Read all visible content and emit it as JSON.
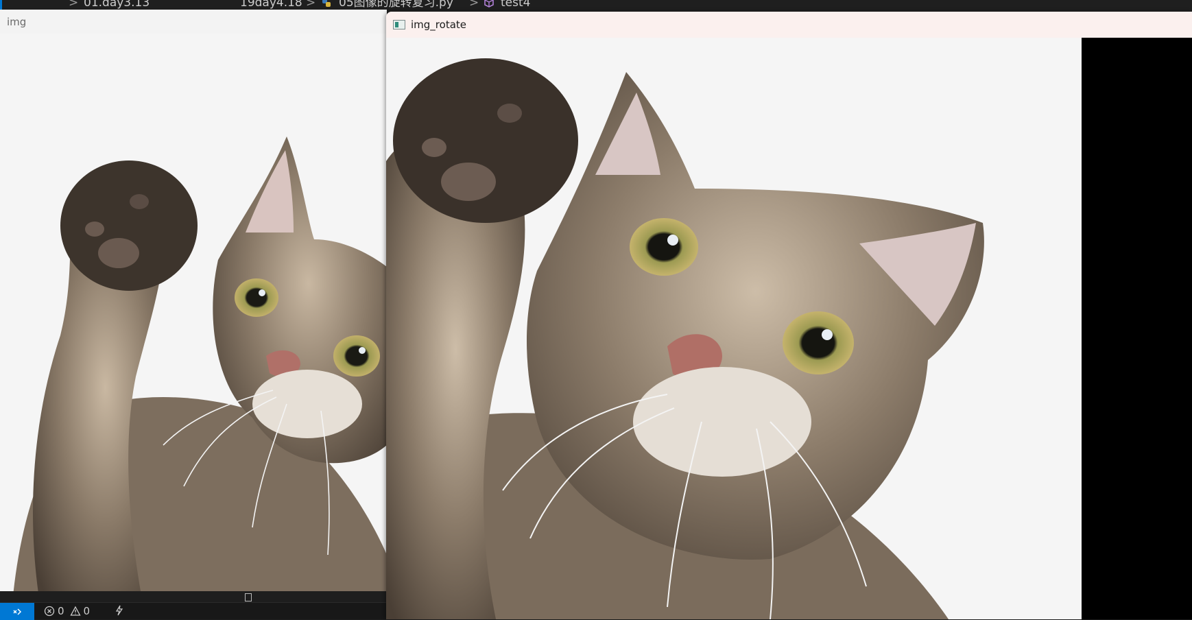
{
  "editor": {
    "breadcrumb": {
      "folder": "01.day3.13",
      "subfolder": "19day4.18",
      "file": "05图像的旋转复习.py",
      "symbol": "test4"
    },
    "statusbar": {
      "errors": "0",
      "warnings": "0"
    }
  },
  "windows": {
    "img": {
      "title": "img",
      "image_subject": "tabby kitten raising its paw"
    },
    "img_rotate": {
      "title": "img_rotate",
      "image_subject": "rotated and enlarged tabby kitten raising its paw"
    }
  },
  "colors": {
    "image_background": "#f5f5f5",
    "rotate_fill": "#000000",
    "accent": "#0078d4"
  },
  "icons": [
    "python-file-icon",
    "symbol-cube-icon",
    "remote-icon",
    "error-icon",
    "warning-icon",
    "lightning-icon",
    "window-app-icon"
  ]
}
